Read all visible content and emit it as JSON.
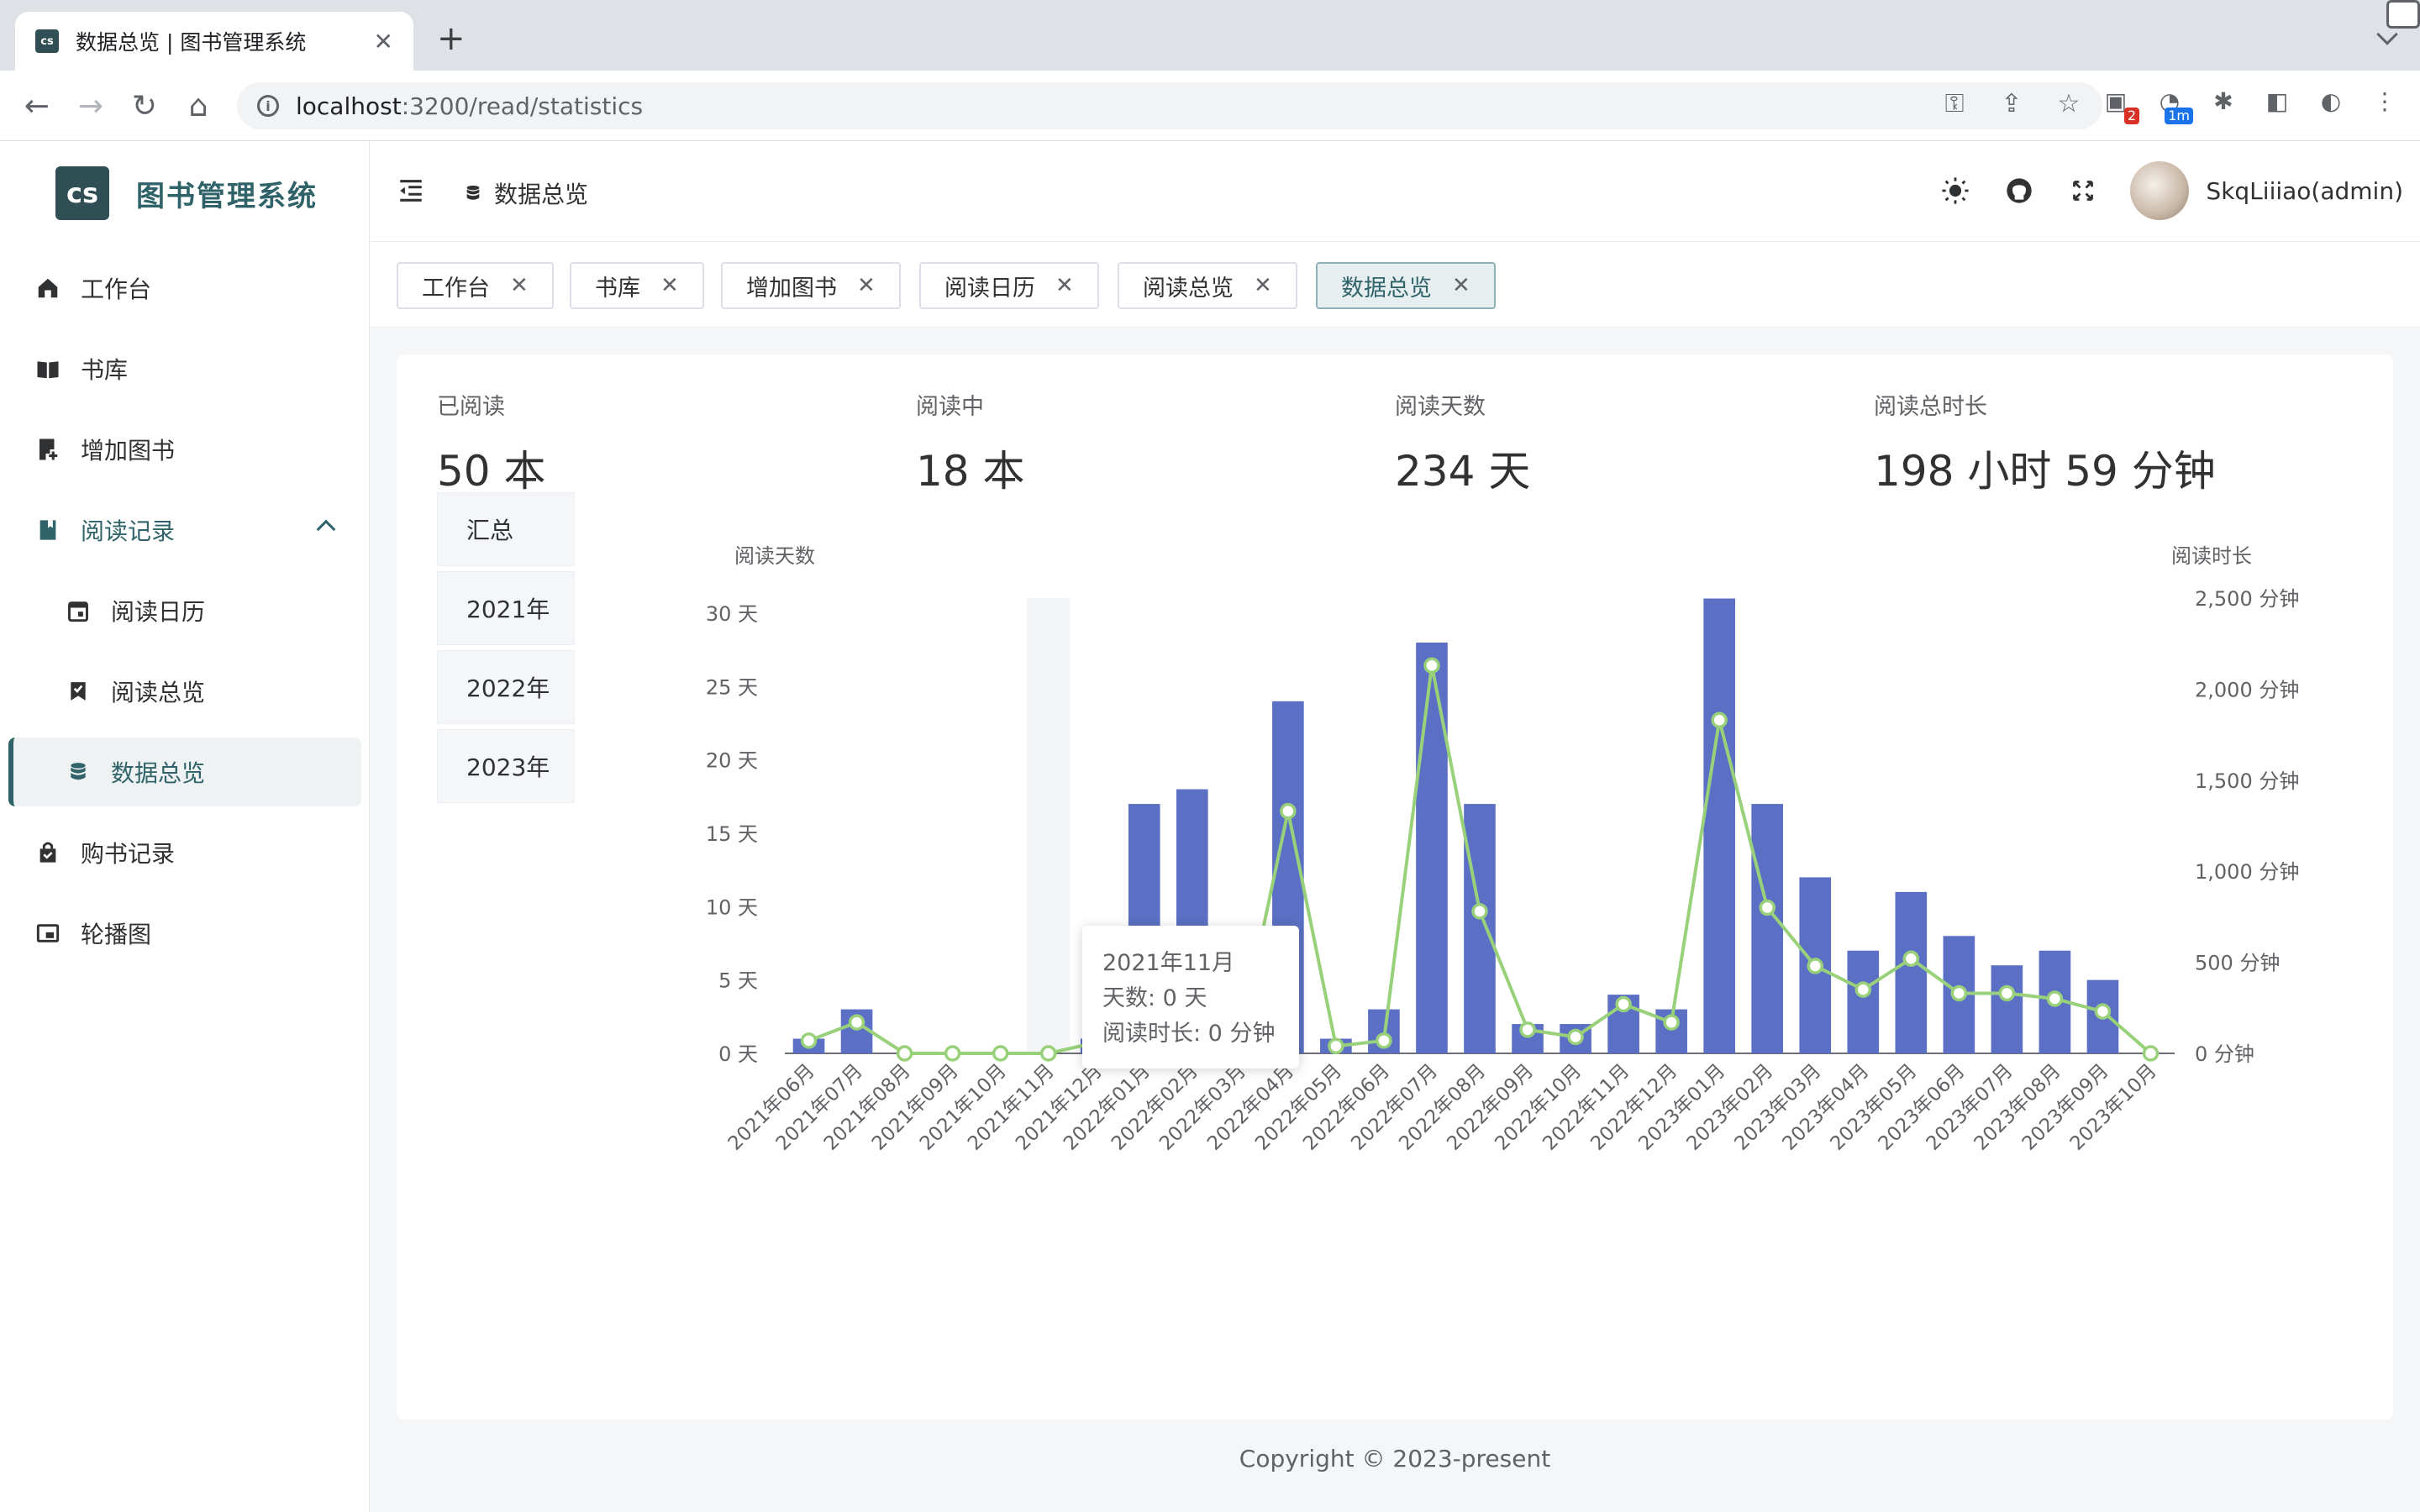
{
  "browser": {
    "tab_title": "数据总览 | 图书管理系统",
    "favicon_text": "cs",
    "url_host": "localhost",
    "url_path": ":3200/read/statistics",
    "ext_badge_1": "2",
    "ext_badge_2": "1m"
  },
  "sidebar": {
    "logo_text": "cs",
    "app_name": "图书管理系统",
    "items": [
      {
        "label": "工作台",
        "icon": "home-icon"
      },
      {
        "label": "书库",
        "icon": "book-open-icon"
      },
      {
        "label": "增加图书",
        "icon": "book-add-icon"
      },
      {
        "label": "阅读记录",
        "icon": "bookmark-icon"
      },
      {
        "label": "阅读日历",
        "icon": "calendar-icon"
      },
      {
        "label": "阅读总览",
        "icon": "checklist-icon"
      },
      {
        "label": "数据总览",
        "icon": "database-icon"
      },
      {
        "label": "购书记录",
        "icon": "shopping-bag-icon"
      },
      {
        "label": "轮播图",
        "icon": "carousel-icon"
      }
    ]
  },
  "header": {
    "breadcrumb": "数据总览",
    "username": "SkqLiiiao(admin)"
  },
  "tags": [
    {
      "label": "工作台"
    },
    {
      "label": "书库"
    },
    {
      "label": "增加图书"
    },
    {
      "label": "阅读日历"
    },
    {
      "label": "阅读总览"
    },
    {
      "label": "数据总览"
    }
  ],
  "stats": [
    {
      "label": "已阅读",
      "value": "50 本"
    },
    {
      "label": "阅读中",
      "value": "18 本"
    },
    {
      "label": "阅读天数",
      "value": "234 天"
    },
    {
      "label": "阅读总时长",
      "value": "198 小时 59 分钟"
    }
  ],
  "year_filters": [
    "汇总",
    "2021年",
    "2022年",
    "2023年"
  ],
  "tooltip": {
    "title": "2021年11月",
    "days": "天数: 0 天",
    "duration": "阅读时长: 0 分钟"
  },
  "footer": "Copyright © 2023-present",
  "colors": {
    "bar": "#5b70c4",
    "line": "#99d17a",
    "accent": "#2f6369"
  },
  "chart_data": {
    "type": "bar",
    "categories": [
      "2021年06月",
      "2021年07月",
      "2021年08月",
      "2021年09月",
      "2021年10月",
      "2021年11月",
      "2021年12月",
      "2022年01月",
      "2022年02月",
      "2022年03月",
      "2022年04月",
      "2022年05月",
      "2022年06月",
      "2022年07月",
      "2022年08月",
      "2022年09月",
      "2022年10月",
      "2022年11月",
      "2022年12月",
      "2023年01月",
      "2023年02月",
      "2023年03月",
      "2023年04月",
      "2023年05月",
      "2023年06月",
      "2023年07月",
      "2023年08月",
      "2023年09月",
      "2023年10月"
    ],
    "series": [
      {
        "name": "阅读天数",
        "type": "bar",
        "axis": "left",
        "values": [
          1,
          3,
          0,
          0,
          0,
          0,
          1,
          17,
          18,
          1,
          24,
          1,
          3,
          28,
          17,
          2,
          2,
          4,
          3,
          31,
          17,
          12,
          7,
          11,
          8,
          6,
          7,
          5,
          0
        ]
      },
      {
        "name": "阅读时长",
        "type": "line",
        "axis": "right",
        "values": [
          70,
          170,
          0,
          0,
          0,
          0,
          60,
          70,
          80,
          90,
          1330,
          40,
          70,
          2130,
          780,
          130,
          90,
          270,
          170,
          1830,
          800,
          480,
          350,
          520,
          330,
          330,
          300,
          230,
          0
        ]
      }
    ],
    "ylabel_left": "阅读天数",
    "ylabel_right": "阅读时长",
    "ylim_left": [
      0,
      30
    ],
    "ylim_right": [
      0,
      2500
    ],
    "yticks_left": [
      "0 天",
      "5 天",
      "10 天",
      "15 天",
      "20 天",
      "25 天",
      "30 天"
    ],
    "yticks_right": [
      "0 分钟",
      "500 分钟",
      "1,000 分钟",
      "1,500 分钟",
      "2,000 分钟",
      "2,500 分钟"
    ],
    "highlight_category": "2021年11月"
  }
}
